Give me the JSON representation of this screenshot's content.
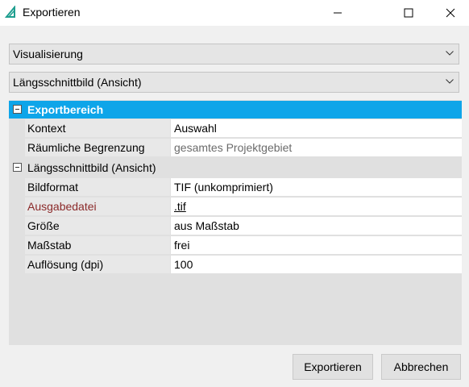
{
  "window": {
    "title": "Exportieren",
    "accent": "#0ea5e9"
  },
  "selects": {
    "first": {
      "value": "Visualisierung"
    },
    "second": {
      "value": "Längsschnittbild (Ansicht)"
    }
  },
  "grid": {
    "category1": {
      "label": "Exportbereich",
      "rows": [
        {
          "name": "Kontext",
          "value": "Auswahl"
        },
        {
          "name": "Räumliche Begrenzung",
          "value": "gesamtes Projektgebiet"
        }
      ]
    },
    "category2": {
      "label": "Längsschnittbild (Ansicht)",
      "rows": [
        {
          "name": "Bildformat",
          "value": "TIF (unkomprimiert)"
        },
        {
          "name": "Ausgabedatei",
          "value": ".tif"
        },
        {
          "name": "Größe",
          "value": "aus Maßstab"
        },
        {
          "name": "Maßstab",
          "value": "frei"
        },
        {
          "name": "Auflösung (dpi)",
          "value": "100"
        }
      ]
    }
  },
  "buttons": {
    "export": "Exportieren",
    "cancel": "Abbrechen"
  }
}
